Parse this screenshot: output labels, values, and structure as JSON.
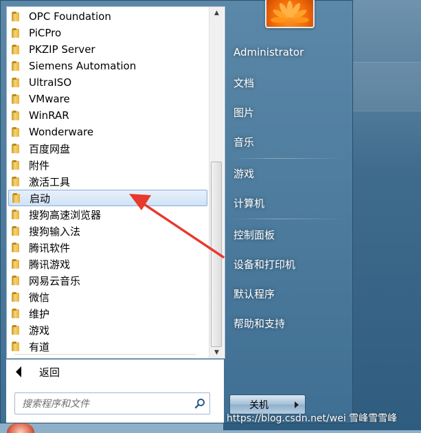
{
  "programs": {
    "items": [
      {
        "label": "OPC Foundation"
      },
      {
        "label": "PiCPro"
      },
      {
        "label": "PKZIP Server"
      },
      {
        "label": "Siemens Automation"
      },
      {
        "label": "UltraISO"
      },
      {
        "label": "VMware"
      },
      {
        "label": "WinRAR"
      },
      {
        "label": "Wonderware"
      },
      {
        "label": "百度网盘"
      },
      {
        "label": "附件"
      },
      {
        "label": "激活工具"
      },
      {
        "label": "启动"
      },
      {
        "label": "搜狗高速浏览器"
      },
      {
        "label": "搜狗输入法"
      },
      {
        "label": "腾讯软件"
      },
      {
        "label": "腾讯游戏"
      },
      {
        "label": "网易云音乐"
      },
      {
        "label": "微信"
      },
      {
        "label": "维护"
      },
      {
        "label": "游戏"
      },
      {
        "label": "有道"
      }
    ],
    "selected_index": 11
  },
  "back": {
    "label": "返回"
  },
  "search": {
    "placeholder": "搜索程序和文件"
  },
  "right": {
    "user": "Administrator",
    "documents": "文档",
    "pictures": "图片",
    "music": "音乐",
    "games": "游戏",
    "computer": "计算机",
    "control_panel": "控制面板",
    "devices": "设备和打印机",
    "default_programs": "默认程序",
    "help": "帮助和支持"
  },
  "shutdown": {
    "label": "关机"
  },
  "watermark": {
    "url": "https://blog.csdn.net/wei",
    "name": "雪峰雪雪峰"
  },
  "colors": {
    "accent": "#3f6f93",
    "arrow": "#e8392c",
    "selected": "#cfe2f6"
  },
  "icons": {
    "folder": "folder-icon",
    "search": "search-icon",
    "back": "back-arrow-icon"
  }
}
